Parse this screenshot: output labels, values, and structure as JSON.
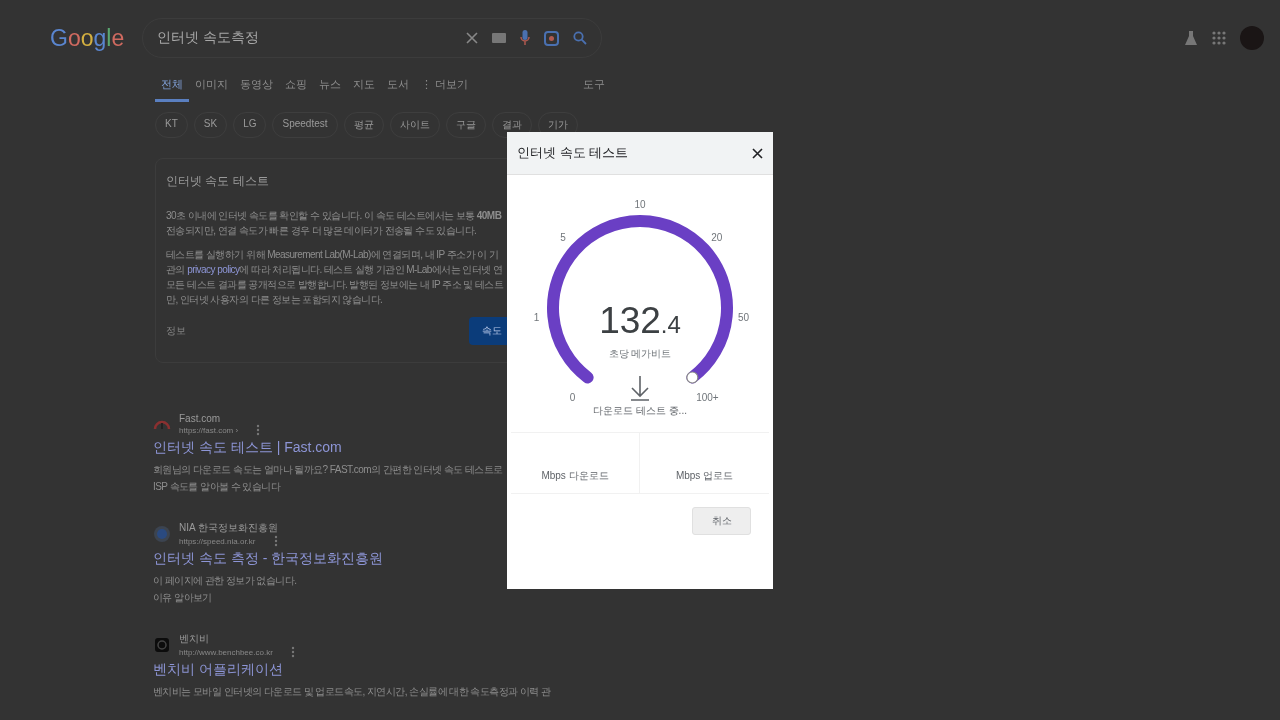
{
  "header": {
    "logo": "Google",
    "query": "인터넷 속도측정"
  },
  "tabs": [
    {
      "label": "전체",
      "selected": true
    },
    {
      "label": "이미지",
      "selected": false
    },
    {
      "label": "동영상",
      "selected": false
    },
    {
      "label": "쇼핑",
      "selected": false
    },
    {
      "label": "뉴스",
      "selected": false
    },
    {
      "label": "지도",
      "selected": false
    },
    {
      "label": "도서",
      "selected": false
    },
    {
      "label": "⋮ 더보기",
      "selected": false
    }
  ],
  "tools": "도구",
  "chips": [
    "KT",
    "SK",
    "LG",
    "Speedtest",
    "평균",
    "사이트",
    "구글",
    "결과",
    "기가"
  ],
  "card": {
    "title": "인터넷 속도 테스트",
    "paragraphs": [
      [
        {
          "text": "30초 이내에 인터넷 속도를 확인할 수 있습니다. 이 속도 테스트에서는 보통 **40MB**"
        },
        {
          "text": "전송되지만, 연결 속도가 빠른 경우 더 많은 데이터가 전송될 수도 있습니다."
        }
      ],
      [
        {
          "text": "테스트를 실행하기 위해 Measurement Lab(M-Lab)에 연결되며, 내 IP 주소가 이 기"
        },
        {
          "text": "관의 ",
          "link": "privacy policy",
          "after": "에 따라 처리됩니다. 테스트 실행 기관인 M-Lab에서는 인터넷 연"
        },
        {
          "text": "모든 테스트 결과를 공개적으로 발행합니다. 발행된 정보에는 내 IP 주소 및 테스트"
        },
        {
          "text": "만, 인터넷 사용자의 다른 정보는 포함되지 않습니다."
        }
      ]
    ],
    "info": "정보",
    "button": "속도"
  },
  "results": [
    {
      "kind": "gauge",
      "site": "Fast.com",
      "url": "https://fast.com ›",
      "title": "인터넷 속도 테스트 | Fast.com",
      "lines": [
        "회원님의 다운로드 속도는 얼마나 될까요? FAST.com의 간편한 인터넷 속도 테스트로",
        "ISP 속도를 알아볼 수 있습니다"
      ]
    },
    {
      "kind": "globe",
      "site": "NIA 한국정보화진흥원",
      "url": "https://speed.nia.or.kr",
      "title": "인터넷 속도 측정 - 한국정보화진흥원",
      "lines": [
        "이 페이지에 관한 정보가 없습니다."
      ],
      "link": "이유 알아보기"
    },
    {
      "kind": "square",
      "site": "벤치비",
      "url": "http://www.benchbee.co.kr",
      "title": "벤치비 어플리케이션",
      "lines": [
        "벤치비는 모바일 인터넷의 다운로드 및 업로드속도, 지연시간, 손실률에 대한 속도측정과 이력 관"
      ]
    }
  ],
  "dialog": {
    "title": "인터넷 속도 테스트",
    "ticks": [
      "0",
      "1",
      "5",
      "10",
      "20",
      "50",
      "100+"
    ],
    "value": "132",
    "decimal": ".4",
    "unit": "초당 메가비트",
    "status": "다운로드 테스트 중...",
    "columns": [
      "Mbps 다운로드",
      "Mbps 업로드"
    ],
    "cancel": "취소"
  }
}
